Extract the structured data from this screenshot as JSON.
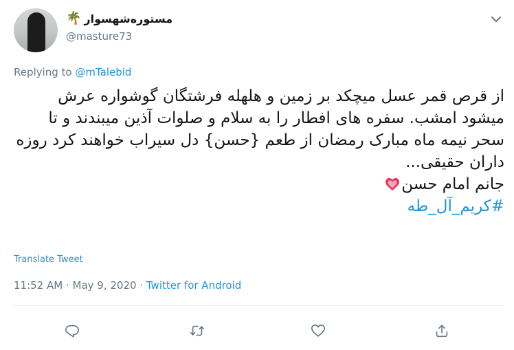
{
  "user": {
    "display_name": "مستوره‌شهسوار",
    "emoji": "🌴",
    "handle": "@masture73"
  },
  "reply": {
    "prefix": "Replying to",
    "mention": "@mTalebid"
  },
  "tweet": {
    "paragraph": "از قرص قمر عسل میچکد بر زمین و هلهله فرشتگان گوشواره عرش میشود امشب. سفره های افطار را به سلام و صلوات آذین میبندند و تا سحر نیمه ماه مبارک رمضان از طعم {حسن} دل سیراب خواهند کرد روزه داران حقیقی...",
    "line2": "جانم امام حسن",
    "hashtag": "#کریم_آل_طه"
  },
  "translate_label": "Translate Tweet",
  "meta": {
    "time": "11:52 AM",
    "sep1": " · ",
    "date": "May 9, 2020",
    "sep2": " · ",
    "source": "Twitter for Android"
  },
  "icons": {
    "caret": "chevron-down-icon",
    "reply": "reply-icon",
    "retweet": "retweet-icon",
    "like": "heart-icon",
    "share": "share-icon",
    "emoji_heart": "sparkling-heart-icon"
  },
  "colors": {
    "link": "#1b95e0",
    "secondary": "#657786",
    "text": "#14171a",
    "heart": "#e8395c"
  }
}
